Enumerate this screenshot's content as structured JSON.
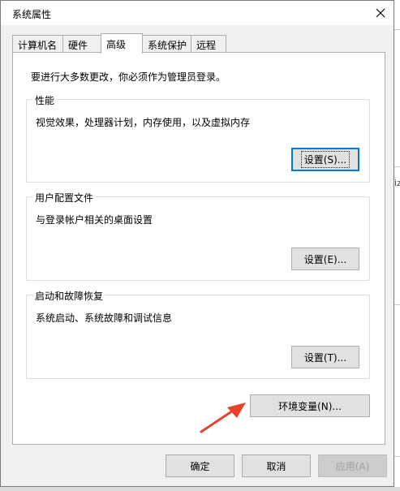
{
  "window": {
    "title": "系统属性"
  },
  "tabs": [
    {
      "label": "计算机名",
      "active": false
    },
    {
      "label": "硬件",
      "active": false
    },
    {
      "label": "高级",
      "active": true
    },
    {
      "label": "系统保护",
      "active": false
    },
    {
      "label": "远程",
      "active": false
    }
  ],
  "notice": "要进行大多数更改，你必须作为管理员登录。",
  "groups": {
    "performance": {
      "title": "性能",
      "desc": "视觉效果，处理器计划，内存使用，以及虚拟内存",
      "button": "设置(S)..."
    },
    "profile": {
      "title": "用户配置文件",
      "desc": "与登录帐户相关的桌面设置",
      "button": "设置(E)..."
    },
    "startup": {
      "title": "启动和故障恢复",
      "desc": "系统启动、系统故障和调试信息",
      "button": "设置(T)..."
    }
  },
  "env_button": "环境变量(N)...",
  "footer": {
    "ok": "确定",
    "cancel": "取消",
    "apply": "应用(A)"
  },
  "background_fragment": "iz",
  "colors": {
    "accent": "#0078d7",
    "arrow": "#e8412c"
  },
  "icons": {
    "close": "close-icon",
    "annotation": "red-arrow-icon"
  }
}
